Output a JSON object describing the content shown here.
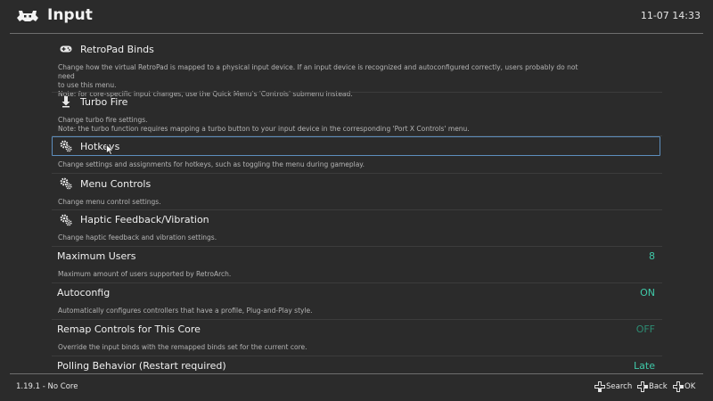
{
  "header": {
    "title": "Input",
    "clock": "11-07 14:33"
  },
  "colors": {
    "value_on": "#3fc9a8",
    "value_off": "#2d8c73",
    "selection": "#5d8ebd"
  },
  "items": [
    {
      "label": "RetroPad Binds",
      "icon": "gamepad-icon",
      "desc": [
        "Change how the virtual RetroPad is mapped to a physical input device. If an input device is recognized and autoconfigured correctly, users probably do not need",
        "to use this menu.",
        "Note: for core-specific input changes, use the Quick Menu's 'Controls' submenu instead."
      ]
    },
    {
      "label": "Turbo Fire",
      "icon": "turbo-icon",
      "desc": [
        "Change turbo fire settings.",
        "Note: the turbo function requires mapping a turbo button to your input device in the corresponding 'Port X Controls' menu."
      ]
    },
    {
      "label": "Hotkeys",
      "icon": "gears-icon",
      "desc": [
        "Change settings and assignments for hotkeys, such as toggling the menu during gameplay."
      ]
    },
    {
      "label": "Menu Controls",
      "icon": "gears-icon",
      "desc": [
        "Change menu control settings."
      ]
    },
    {
      "label": "Haptic Feedback/Vibration",
      "icon": "gears-icon",
      "desc": [
        "Change haptic feedback and vibration settings."
      ]
    },
    {
      "label": "Maximum Users",
      "value": "8",
      "desc": [
        "Maximum amount of users supported by RetroArch."
      ]
    },
    {
      "label": "Autoconfig",
      "value": "ON",
      "desc": [
        "Automatically configures controllers that have a profile, Plug-and-Play style."
      ]
    },
    {
      "label": "Remap Controls for This Core",
      "value": "OFF",
      "desc": [
        "Override the input binds with the remapped binds set for the current core."
      ]
    },
    {
      "label": "Polling Behavior (Restart required)",
      "value": "Late"
    }
  ],
  "footer": {
    "version": "1.19.1 - No Core",
    "search": "Search",
    "back": "Back",
    "ok": "OK"
  }
}
